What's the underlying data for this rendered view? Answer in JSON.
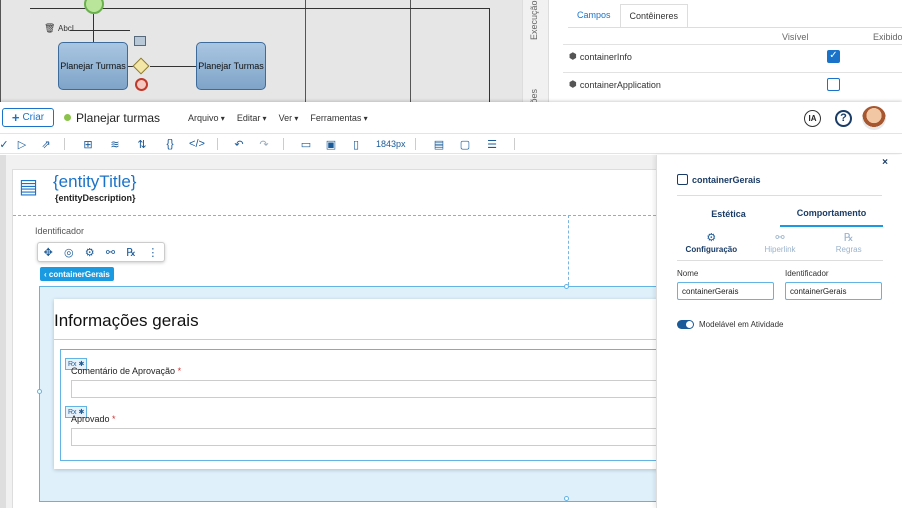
{
  "bpmn": {
    "task1": "Planejar Turmas",
    "task2": "Planejar Turmas",
    "abc_label": "AbcI"
  },
  "bg_panel": {
    "vtab1": "Execução",
    "vtab2": "ções",
    "tabs": [
      "Campos",
      "Contêineres"
    ],
    "col_visible": "Visível",
    "col_shown": "Exibido",
    "rows": [
      {
        "name": "containerInfo",
        "visible": true,
        "shown": "-"
      },
      {
        "name": "containerApplication",
        "visible": false,
        "shown": "-"
      }
    ]
  },
  "topbar": {
    "create_label": "Criar",
    "app_title": "Planejar turmas",
    "menus": [
      "Arquivo",
      "Editar",
      "Ver",
      "Ferramentas"
    ],
    "ia_label": "IA",
    "help_label": "?"
  },
  "toolbar": {
    "size_label": "1843px"
  },
  "canvas": {
    "entity_title": "{entityTitle}",
    "entity_description": "{entityDescription}",
    "identifier_label": "Identificador",
    "component_tag": "‹ containerGerais",
    "section_title": "Informações gerais",
    "rx_label": "Rx",
    "fields": [
      {
        "label": "Comentário de Aprovação",
        "required": "*"
      },
      {
        "label": "Aprovado",
        "required": "*"
      }
    ]
  },
  "props": {
    "close": "×",
    "component_name": "containerGerais",
    "tabs": [
      "Estética",
      "Comportamento"
    ],
    "subtabs": [
      "Configuração",
      "Hiperlink",
      "Regras"
    ],
    "name_label": "Nome",
    "name_value": "containerGerais",
    "id_label": "Identificador",
    "id_value": "containerGerais",
    "toggle_label": "Modelável em Atividade"
  },
  "colors": {
    "accent": "#1a73c9",
    "selection": "#63b3e3",
    "dark": "#1a3c66"
  }
}
